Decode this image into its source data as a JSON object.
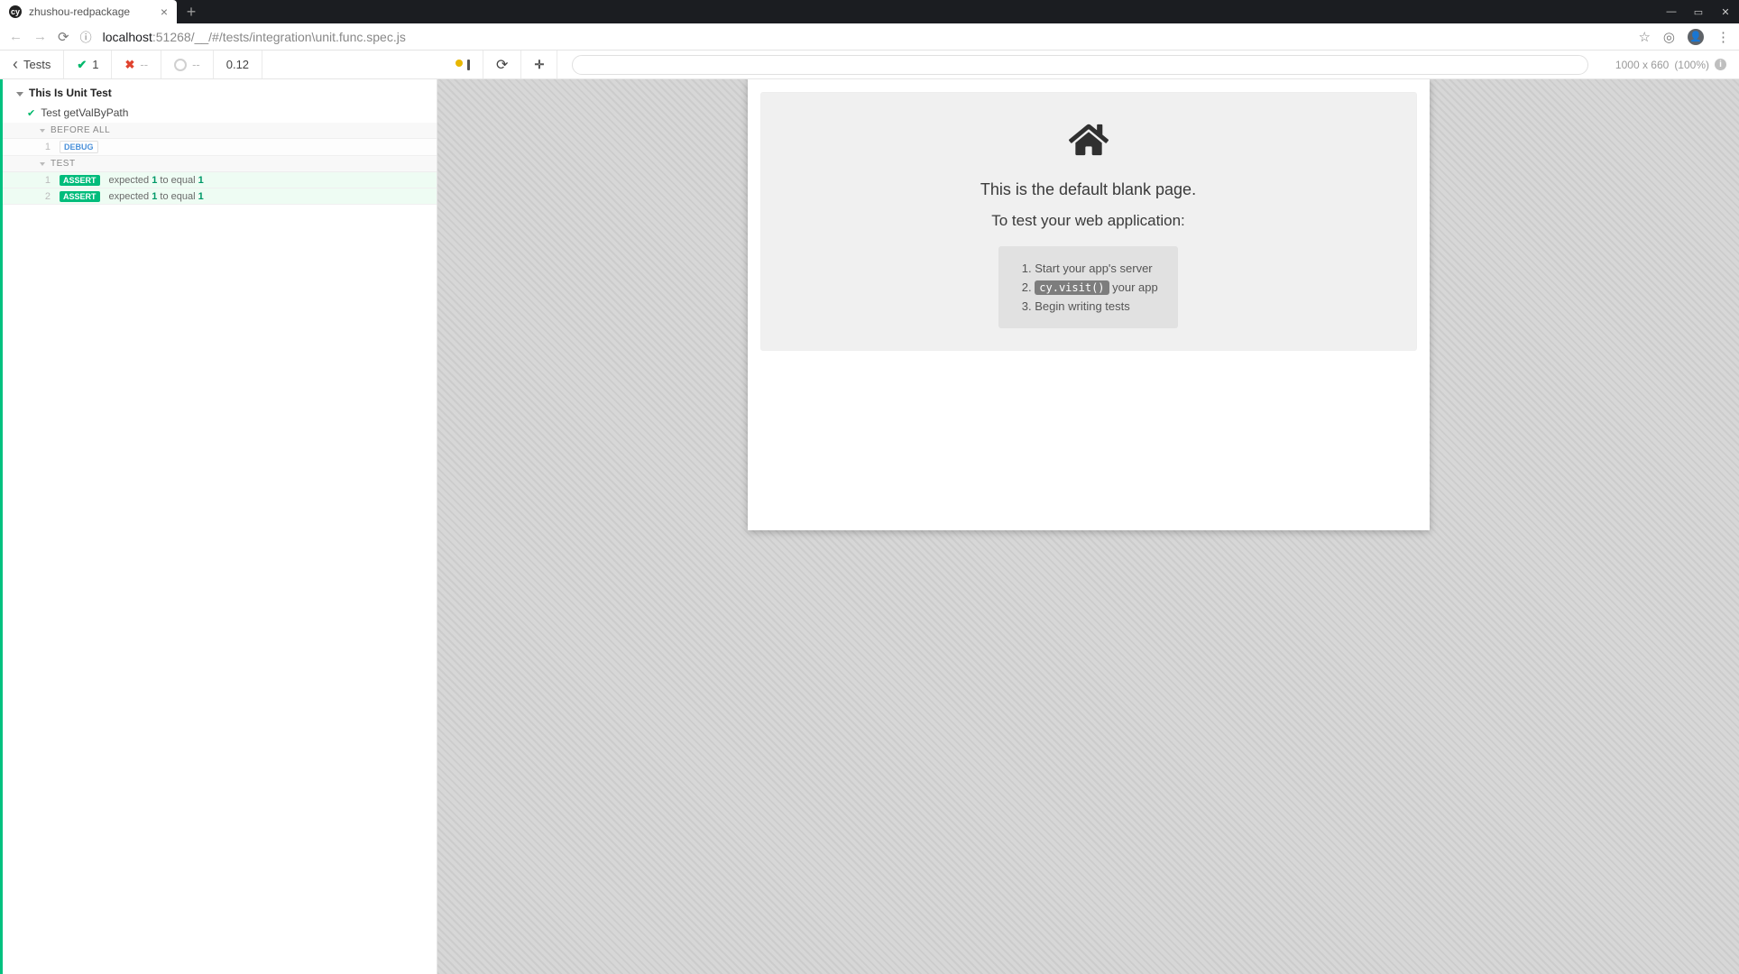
{
  "browser": {
    "tab_title": "zhushou-redpackage",
    "favicon_text": "cy",
    "url_host": "localhost",
    "url_port": ":51268",
    "url_path": "/__/#/tests/integration\\unit.func.spec.js"
  },
  "runner_header": {
    "back_label": "Tests",
    "pass_count": "1",
    "fail_count": "--",
    "pending_count": "--",
    "duration": "0.12",
    "viewport_dims": "1000 x 660",
    "viewport_scale": "(100%)"
  },
  "reporter": {
    "suite_title": "This Is Unit Test",
    "test_title": "Test getValByPath",
    "sections": {
      "before_all": {
        "label": "BEFORE ALL",
        "rows": [
          {
            "idx": "1",
            "tag": "DEBUG"
          }
        ]
      },
      "test": {
        "label": "TEST",
        "rows": [
          {
            "idx": "1",
            "tag": "ASSERT",
            "msg_prefix": "expected ",
            "val1": "1",
            "mid": " to equal ",
            "val2": "1"
          },
          {
            "idx": "2",
            "tag": "ASSERT",
            "msg_prefix": "expected ",
            "val1": "1",
            "mid": " to equal ",
            "val2": "1"
          }
        ]
      }
    }
  },
  "app": {
    "heading1": "This is the default blank page.",
    "heading2": "To test your web application:",
    "steps": {
      "s1": "Start your app's server",
      "s2_code": "cy.visit()",
      "s2_tail": " your app",
      "s3": "Begin writing tests"
    }
  }
}
